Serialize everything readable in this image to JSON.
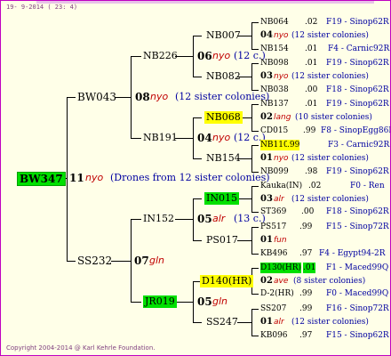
{
  "header": "19-  9-2014 ( 23: 4)",
  "footer": "Copyright 2004-2014 @ Karl Kehrle Foundation.",
  "root": {
    "id": "BW347",
    "gen": "11",
    "mark": "nyo",
    "note": "(Drones from 12 sister colonies)"
  },
  "g1": [
    {
      "id": "BW043"
    },
    {
      "id": "SS232",
      "gen": "07",
      "mark": "gln"
    }
  ],
  "g1_top": {
    "gen": "08",
    "mark": "nyo",
    "note": "(12 sister colonies)"
  },
  "g2": [
    {
      "id": "NB226",
      "gen": "06",
      "mark": "nyo",
      "note": "(12 c.)"
    },
    {
      "id": "NB191",
      "gen": "04",
      "mark": "nyo",
      "note": "(12 c.)"
    },
    {
      "id": "IN152",
      "gen": "05",
      "mark": "alr",
      "note": "(13 c.)"
    },
    {
      "id": "JR019",
      "gen": "05",
      "mark": "gln"
    }
  ],
  "g3": [
    {
      "id": "NB007"
    },
    {
      "id": "NB082"
    },
    {
      "id": "NB068"
    },
    {
      "id": "NB154"
    },
    {
      "id": "IN015"
    },
    {
      "id": "PS017"
    },
    {
      "id": "D140(HR)"
    },
    {
      "id": "SS247"
    }
  ],
  "g3_marks": [
    {
      "gen": "03",
      "mark": "alr",
      "note": "(12 sister colonies)"
    },
    {
      "gen": "01",
      "mark": "fun"
    },
    {
      "gen": "02",
      "mark": "ave",
      "note": "(8 sister colonies)"
    },
    {
      "gen": "01",
      "mark": "alr",
      "note": "(12 sister colonies)"
    }
  ],
  "g4": [
    {
      "id": "NB064",
      "val": ".02",
      "pid": "F19 - Sinop62R"
    },
    {
      "gen": "04",
      "mark": "nyo",
      "note": "(12 sister colonies)"
    },
    {
      "id": "NB154",
      "val": ".01",
      "pid": "F4 - Carnic92R"
    },
    {
      "id": "NB098",
      "val": ".01",
      "pid": "F19 - Sinop62R"
    },
    {
      "gen": "03",
      "mark": "nyo",
      "note": "(12 sister colonies)"
    },
    {
      "id": "NB038",
      "val": ".00",
      "pid": "F18 - Sinop62R"
    },
    {
      "id": "NB137",
      "val": ".01",
      "pid": "F19 - Sinop62R"
    },
    {
      "gen": "02",
      "mark": "lang",
      "note": "(10 sister colonies)"
    },
    {
      "id": "CD015",
      "val": ".99",
      "pid": "F8 - SinopEgg86R"
    },
    {
      "id": "NB110",
      "val": ".99",
      "pid": "F3 - Carnic92R"
    },
    {
      "gen": "01",
      "mark": "nyo",
      "note": "(12 sister colonies)"
    },
    {
      "id": "NB099",
      "val": ".98",
      "pid": "F19 - Sinop62R"
    },
    {
      "id": "Kauka(IN)",
      "val": ".02",
      "pid": "F0 - Ren"
    },
    {
      "id": "ST369",
      "val": ".00",
      "pid": "F18 - Sinop62R"
    },
    {
      "id": "PS517",
      "val": ".99",
      "pid": "F15 - Sinop72R"
    },
    {
      "id": "KB496",
      "val": ".97",
      "pid": "F4 - Egypt94-2R"
    },
    {
      "id": "D130(HR)",
      "val": ".01",
      "pid": "F1 - Maced99Q"
    },
    {
      "id": "D-2(HR)",
      "val": ".99",
      "pid": "F0 - Maced99Q"
    },
    {
      "id": "SS207",
      "val": ".99",
      "pid": "F16 - Sinop72R"
    },
    {
      "id": "KB096",
      "val": ".97",
      "pid": "F15 - Sinop62R"
    }
  ]
}
